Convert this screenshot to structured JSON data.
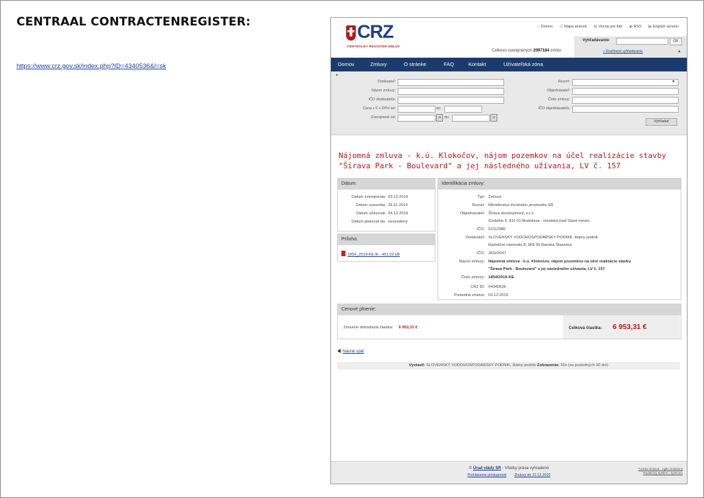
{
  "doc": {
    "title": "CENTRAAL CONTRACTENREGISTER:",
    "link": "https://www.crz.gov.sk/index.php?ID=4340536&l=sk"
  },
  "site": {
    "logo_text": "CRZ",
    "logo_sub": "CENTRÁLNY REGISTER ZMLÚV",
    "toplinks": [
      "Domov",
      "Mapa stránok",
      "Verzia pre tlač",
      "RSS",
      "English version"
    ],
    "toplink_icons": [
      "home-icon",
      "sitemap-icon",
      "print-icon",
      "rss-icon",
      "flag-icon"
    ],
    "count_prefix": "Celkovo zverejnených",
    "count_value": "2097184",
    "count_suffix": "zmlúv",
    "search_label": "Vyhľadávanie",
    "search_ok": "OK",
    "adv_search": "Rozšírené vyhľadávanie"
  },
  "nav": [
    "Domov",
    "Zmluvy",
    "O stránke",
    "FAQ",
    "Kontakt",
    "Užívateľská zóna"
  ],
  "filter": {
    "left_labels": [
      "Dodávateľ:",
      "Názov zmluvy:",
      "IČO dodávateľa:",
      "Cena v € s DPH od:",
      "Zverejnené od:"
    ],
    "do_label": "do:",
    "right_labels": [
      "Rezort:",
      "Objednávateľ:",
      "Číslo zmluvy:",
      "IČO objednávateľa:"
    ],
    "cal": "28",
    "search_button": "Vyhľadať"
  },
  "contract": {
    "title": "Nájomná zmluva - k.ú. Klokočov, nájom pozemkov na účel realizácie stavby \"Šírava Park - Boulevard\" a jej následného užívania, LV č. 157"
  },
  "dates": {
    "header": "Dátum:",
    "rows": [
      {
        "k": "Dátum zverejnenia:",
        "v": "03.12.2019"
      },
      {
        "k": "Dátum uzavretia:",
        "v": "26.11.2019"
      },
      {
        "k": "Dátum účinnosti:",
        "v": "04.12.2019"
      },
      {
        "k": "Dátum platnosti do:",
        "v": "neuvedený"
      }
    ]
  },
  "attachment": {
    "header": "Príloha:",
    "file": "1854_2019-KE.fit - 451.02 kB"
  },
  "ident": {
    "header": "Identifikácia zmluvy:",
    "typ_k": "Typ:",
    "typ_v": "Zmluva",
    "rezort_k": "Rezort:",
    "rezort_v": "Ministerstvo životného prostredia SR",
    "obj_k": "Objednávateľ:",
    "obj_v1": "Šírava development, s.r.o.",
    "obj_v2": "Gorkého 5, 811 01 Bratislava - mestská časť Staré mesto",
    "ico1_k": "IČO:",
    "ico1_v": "52112985",
    "dod_k": "Dodávateľ:",
    "dod_v1": "SLOVENSKÝ VODOHOSPODÁRSKY PODNIK, štátny podnik",
    "dod_v2": "Radničné námestie 8, 969 55 Banská Štiavnica",
    "ico2_k": "IČO:",
    "ico2_v": "36022047",
    "nazov_k": "Názov zmluvy:",
    "nazov_v1": "Nájomná zmluva - k.ú. Klokočov, nájom pozemkov na účel realizácie stavby",
    "nazov_v2": "\"Šírava Park - Boulevard\" a jej následného užívania, LV č. 157",
    "cislo_k": "Číslo zmluvy:",
    "cislo_v": "1854/2019-KE",
    "crz_k": "CRZ ID:",
    "crz_v": "#4340536",
    "zmena_k": "Posledná zmena:",
    "zmena_v": "03.12.2019"
  },
  "price": {
    "header": "Cenové plnenie:",
    "agreed_label": "Zmluvne dohodnutá čiastka:",
    "agreed_value": "6 953,31 €",
    "total_label": "Celková čiastka:",
    "total_value": "6 953,31 €"
  },
  "back": "Návrat späť",
  "issued": {
    "k1": "Vystavil:",
    "v1": "SLOVENSKÝ VODOHOSPODÁRSKY PODNIK, štátny podnik",
    "k2": "Zobrazenia:",
    "v2": "16x (za posledných 30 dní)"
  },
  "footer": {
    "copyright": "©",
    "office": "Úrad vlády SR",
    "rights": " - Všetky práva vyhradené",
    "link1": "Prehlásenie prístupnosti",
    "link2": "Zmluvy do 31.12.2010",
    "right1": "Tvorba stránok : Agile Solutions",
    "right2": "Redakčný systém : SynCom"
  }
}
